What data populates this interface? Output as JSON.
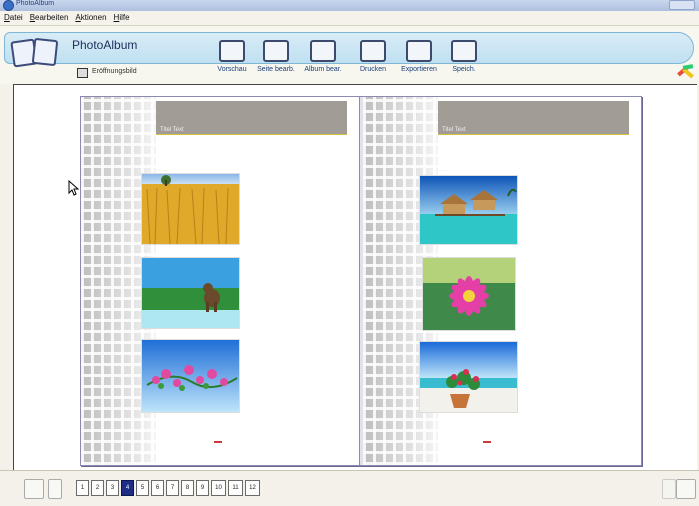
{
  "window": {
    "title": "PhotoAlbum"
  },
  "menu": [
    "Datei",
    "Bearbeiten",
    "Aktionen",
    "Hilfe"
  ],
  "app": {
    "name": "PhotoAlbum",
    "context_label": "Eröffnungsbild"
  },
  "toolbar": [
    {
      "label": "Vorschau",
      "icon": "preview-icon"
    },
    {
      "label": "Seite bearb.",
      "icon": "edit-page-icon"
    },
    {
      "label": "Album bear.",
      "icon": "edit-album-icon"
    },
    {
      "label": "Drucken",
      "icon": "print-icon"
    },
    {
      "label": "Exportieren",
      "icon": "export-icon"
    },
    {
      "label": "Speich.",
      "icon": "save-icon"
    }
  ],
  "album": {
    "left_page": {
      "header": "Titel Text",
      "photos": [
        "wheat-field-photo",
        "dog-photo",
        "flowers-sky-photo"
      ]
    },
    "right_page": {
      "header": "Titel Text",
      "photos": [
        "bungalows-photo",
        "pink-flower-photo",
        "beach-plant-photo"
      ]
    }
  },
  "pagination": {
    "pages": [
      "1",
      "2",
      "3",
      "4",
      "5",
      "6",
      "7",
      "8",
      "9",
      "10",
      "11",
      "12"
    ],
    "current": "4"
  },
  "colors": {
    "ribbon": "#bfe0f1",
    "active_page": "#1d2d86",
    "header_band": "#a19c96"
  }
}
